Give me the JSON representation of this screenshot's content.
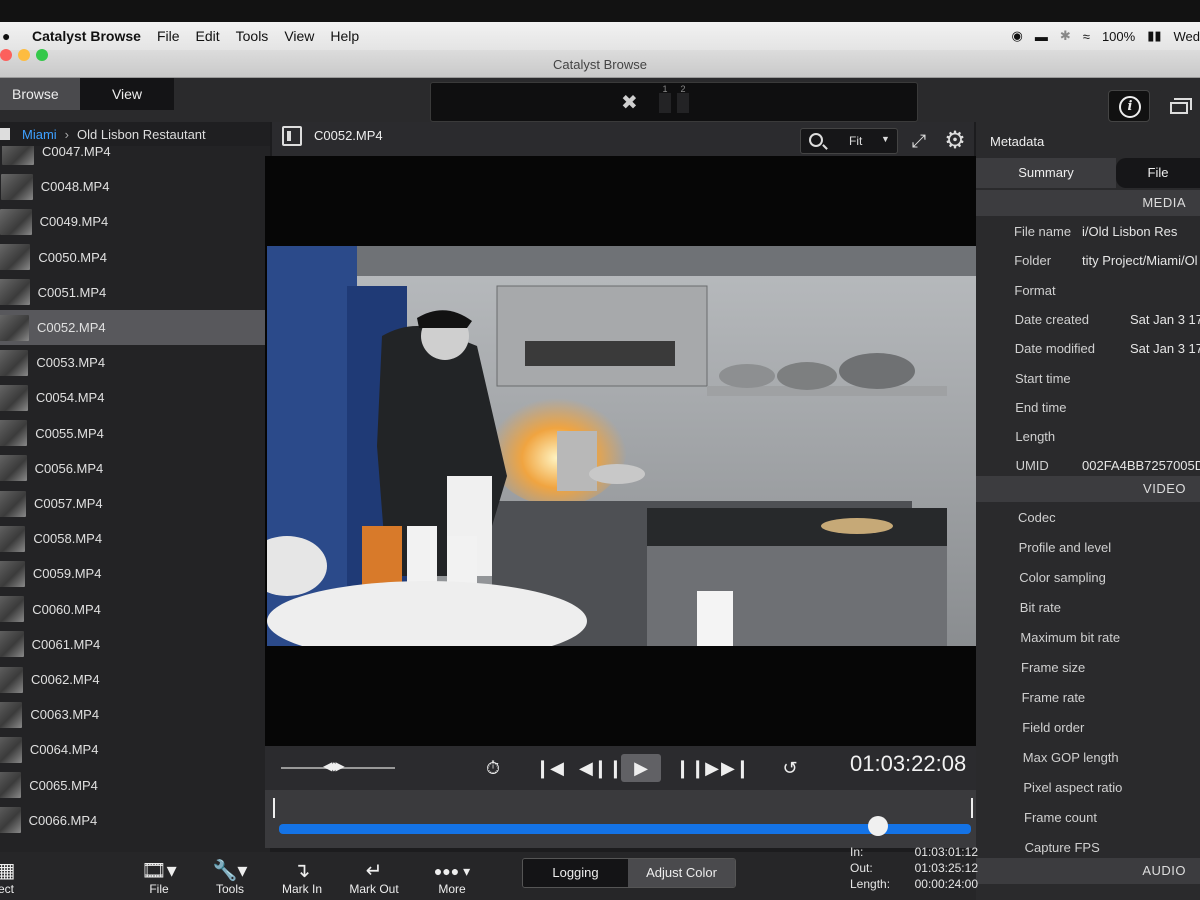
{
  "menubar": {
    "app_name": "Catalyst Browse",
    "menus": [
      "File",
      "Edit",
      "Tools",
      "View",
      "Help"
    ],
    "battery": "100%",
    "clock": "Wed"
  },
  "window": {
    "title": "Catalyst Browse"
  },
  "toolbar": {
    "modes": [
      "Browse",
      "View"
    ],
    "channel_1": "1",
    "channel_2": "2"
  },
  "browser": {
    "breadcrumb": {
      "location": "Miami",
      "folder": "Old Lisbon Restautant"
    },
    "clips": [
      "C0047.MP4",
      "C0048.MP4",
      "C0049.MP4",
      "C0050.MP4",
      "C0051.MP4",
      "C0052.MP4",
      "C0053.MP4",
      "C0054.MP4",
      "C0055.MP4",
      "C0056.MP4",
      "C0057.MP4",
      "C0058.MP4",
      "C0059.MP4",
      "C0060.MP4",
      "C0061.MP4",
      "C0062.MP4",
      "C0063.MP4",
      "C0064.MP4",
      "C0065.MP4",
      "C0066.MP4"
    ],
    "selected_clip": "C0052.MP4"
  },
  "viewer": {
    "file_name": "C0052.MP4",
    "zoom": "Fit",
    "timecode": "01:03:22:08"
  },
  "metadata": {
    "title": "Metadata",
    "tabs": [
      "Summary",
      "File"
    ],
    "sections": {
      "media": "MEDIA",
      "video": "VIDEO",
      "audio": "AUDIO"
    },
    "media_rows": [
      {
        "key": "File name",
        "value": "i/Old Lisbon Res"
      },
      {
        "key": "Folder",
        "value": "tity Project/Miami/Ol"
      },
      {
        "key": "Format",
        "value": ""
      },
      {
        "key": "Date created",
        "value": "Sat Jan  3 17:"
      },
      {
        "key": "Date modified",
        "value": "Sat Jan  3 17:"
      },
      {
        "key": "Start time",
        "value": ""
      },
      {
        "key": "End time",
        "value": ""
      },
      {
        "key": "Length",
        "value": ""
      },
      {
        "key": "UMID",
        "value": "002FA4BB7257005D"
      }
    ],
    "video_rows": [
      "Codec",
      "Profile and level",
      "Color sampling",
      "Bit rate",
      "Maximum bit rate",
      "Frame size",
      "Frame rate",
      "Field order",
      "Max GOP length",
      "Pixel aspect ratio",
      "Frame count",
      "Capture FPS"
    ]
  },
  "bottombar": {
    "left_partial": "ect",
    "file_label": "File",
    "tools_label": "Tools",
    "mark_in_label": "Mark In",
    "mark_out_label": "Mark Out",
    "more_label": "More",
    "logging_label": "Logging",
    "adjust_color_label": "Adjust Color",
    "in_label": "In:",
    "in_value": "01:03:01:12",
    "out_label": "Out:",
    "out_value": "01:03:25:12",
    "length_label": "Length:",
    "length_value": "00:00:24:00"
  },
  "playback": {
    "position": 0.865
  }
}
